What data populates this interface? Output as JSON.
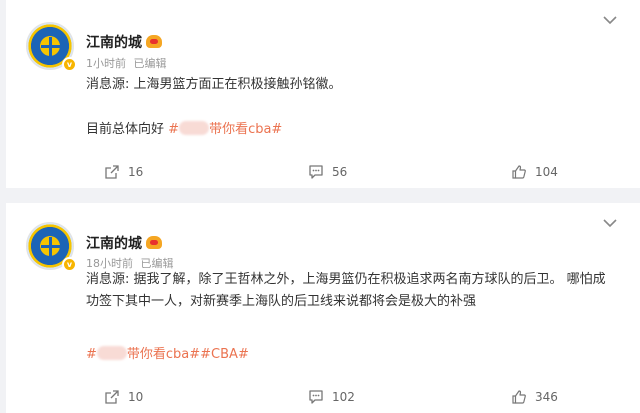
{
  "posts": [
    {
      "author": "江南的城",
      "time": "1小时前",
      "edited": "已编辑",
      "text_main": "消息源: 上海男篮方面正在积极接触孙铭徽。",
      "text_lead": "目前总体向好",
      "hashtag_open": "#",
      "hashtag_text": "带你看cba#",
      "reposts": "16",
      "comments": "56",
      "likes": "104"
    },
    {
      "author": "江南的城",
      "time": "18小时前",
      "edited": "已编辑",
      "text_main": "消息源: 据我了解，除了王哲林之外，上海男篮仍在积极追求两名南方球队的后卫。 哪怕成功签下其中一人，对新赛季上海队的后卫线来说都将会是极大的补强",
      "hashtag_open": "#",
      "hashtag_text": "带你看cba##CBA#",
      "reposts": "10",
      "comments": "102",
      "likes": "346"
    }
  ],
  "icons": {
    "more": "chevron-down-icon",
    "repost": "share-icon",
    "comment": "comment-icon",
    "like": "thumb-up-icon",
    "verified": "verified-badge-icon",
    "vip": "vip-badge-icon"
  },
  "colors": {
    "hashtag": "#eb7350",
    "background": "#f1f2f5",
    "meta": "#999999"
  }
}
